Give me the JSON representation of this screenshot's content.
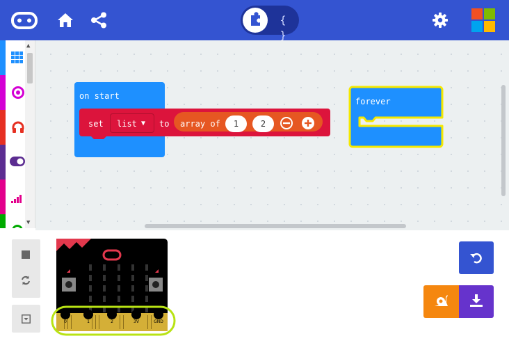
{
  "header": {
    "editor_toggle": {
      "blocks_icon": "puzzle-icon",
      "javascript_label": "{ }"
    },
    "icons": [
      "microbit-logo-icon",
      "home-icon",
      "share-icon",
      "gear-icon",
      "microsoft-logo-icon"
    ]
  },
  "toolbox": {
    "categories": [
      {
        "name": "Basic",
        "icon": "grid-icon",
        "color": "#1E90FF"
      },
      {
        "name": "Input",
        "icon": "target-icon",
        "color": "#D400D4"
      },
      {
        "name": "Music",
        "icon": "headphones-icon",
        "color": "#E63022"
      },
      {
        "name": "Led",
        "icon": "toggle-icon",
        "color": "#5C2D91"
      },
      {
        "name": "Radio",
        "icon": "signal-icon",
        "color": "#E3008C"
      },
      {
        "name": "Loops",
        "icon": "loop-icon",
        "color": "#00AA00"
      }
    ]
  },
  "workspace": {
    "on_start": {
      "label": "on start",
      "set_block": {
        "set_label": "set",
        "variable": "list",
        "to_label": "to",
        "array_label": "array of",
        "values": [
          "1",
          "2"
        ]
      }
    },
    "forever": {
      "label": "forever"
    }
  },
  "simulator": {
    "pins": [
      "0",
      "1",
      "2",
      "3V",
      "GND"
    ]
  },
  "colors": {
    "topbar": "#3454D1",
    "event_block": "#1E90FF",
    "variable_block": "#DC143C",
    "array_block": "#E65722",
    "highlight": "#B8E314",
    "download_button": "#6633CC",
    "slow_motion_button": "#F5870F",
    "undo_button": "#3454D1"
  }
}
